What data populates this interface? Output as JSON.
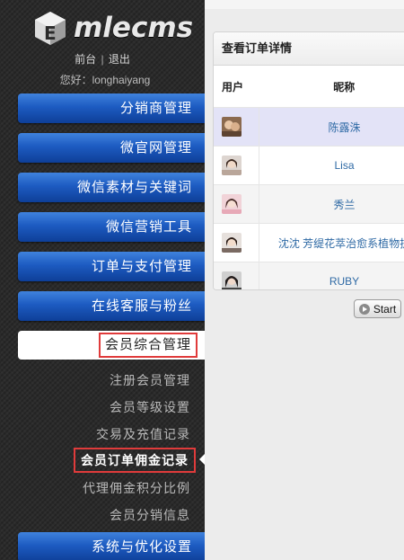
{
  "brand": {
    "name": "mlecms"
  },
  "top_links": {
    "front": "前台",
    "separator": "|",
    "logout": "退出"
  },
  "greeting": "您好：longhaiyang",
  "menu": [
    "分销商管理",
    "微官网管理",
    "微信素材与关键词",
    "微信营销工具",
    "订单与支付管理",
    "在线客服与粉丝"
  ],
  "active_menu": "会员综合管理",
  "submenu": [
    "注册会员管理",
    "会员等级设置",
    "交易及充值记录",
    "会员订单佣金记录",
    "代理佣金积分比例",
    "会员分销信息"
  ],
  "bottom_menu": "系统与优化设置",
  "panel": {
    "title": "查看订单详情",
    "columns": [
      "用户",
      "昵称"
    ],
    "rows": [
      {
        "nickname": "陈露洙"
      },
      {
        "nickname": "Lisa"
      },
      {
        "nickname": "秀兰"
      },
      {
        "nickname": "沈沈 芳缇花萃治愈系植物护"
      },
      {
        "nickname": "RUBY"
      }
    ]
  },
  "start_button": "Start",
  "colors": {
    "menu_blue": "#1d5bc1",
    "highlight_red": "#e03b3b",
    "link_blue": "#2f6aa5",
    "selected_row": "#e3e3f7"
  }
}
